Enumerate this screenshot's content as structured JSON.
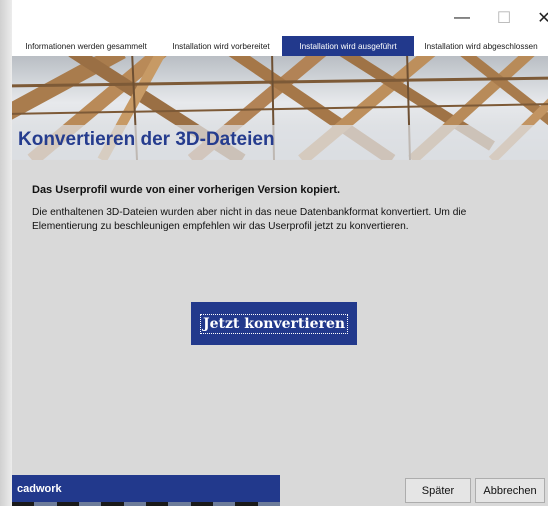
{
  "window": {
    "controls": {
      "minimize": "—",
      "maximize": "☐",
      "close": "✕"
    }
  },
  "tabs": [
    {
      "label": "Informationen werden gesammelt",
      "active": false
    },
    {
      "label": "Installation wird vorbereitet",
      "active": false
    },
    {
      "label": "Installation wird ausgeführt",
      "active": true
    },
    {
      "label": "Installation wird abgeschlossen",
      "active": false
    }
  ],
  "banner": {
    "title": "Konvertieren der 3D-Dateien"
  },
  "message": {
    "title": "Das Userprofil wurde von einer vorherigen Version kopiert.",
    "body": "Die enthaltenen 3D-Dateien wurden aber nicht in das neue Datenbankformat konvertiert. Um die Elementierung zu beschleunigen empfehlen wir das Userprofil jetzt zu konvertieren."
  },
  "actions": {
    "convert_label": "Jetzt konvertieren",
    "later_label": "Später",
    "cancel_label": "Abbrechen"
  },
  "footer": {
    "brand": "cadwork"
  },
  "colors": {
    "accent": "#22398c",
    "title_blue": "#253c8e",
    "background": "#d9d9d9"
  }
}
